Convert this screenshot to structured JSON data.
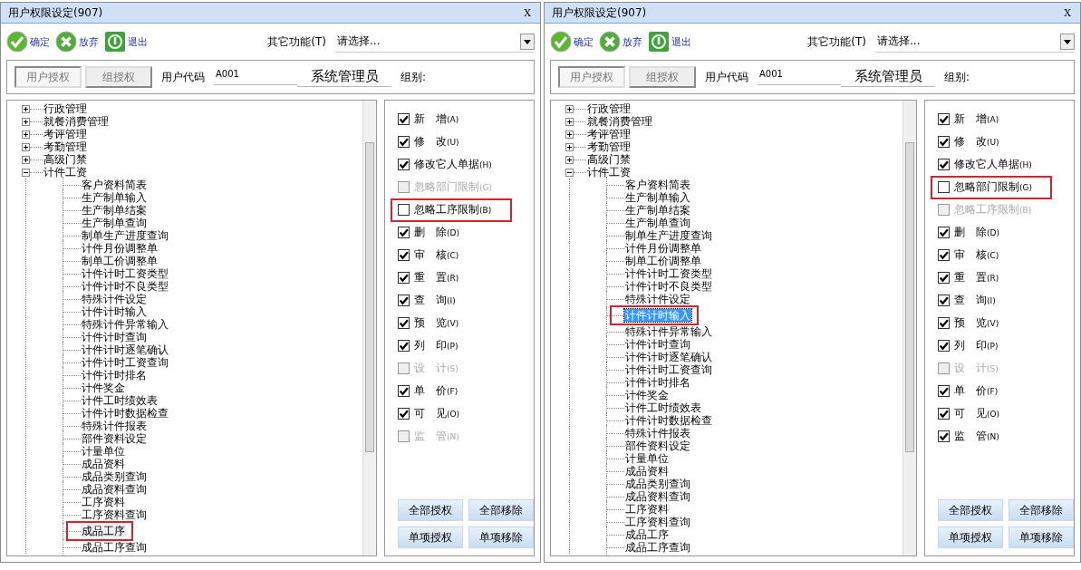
{
  "windows": [
    {
      "title": "用户权限设定(907)",
      "close": "X",
      "tree_focused": false,
      "toolbar": [
        {
          "kind": "ok",
          "label": "确定"
        },
        {
          "kind": "cancel",
          "label": "放弃"
        },
        {
          "kind": "exit",
          "label": "退出"
        }
      ],
      "other_label": "其它功能(T)",
      "other_value": "请选择...",
      "tabs": [
        {
          "label": "用户授权",
          "selected": true
        },
        {
          "label": "组授权",
          "selected": false
        }
      ],
      "user_code_label": "用户代码",
      "user_code": "A001",
      "user_name": "系统管理员",
      "group_label": "组别:",
      "tree": [
        {
          "label": "行政管理",
          "expanded": false
        },
        {
          "label": "就餐消费管理",
          "expanded": false
        },
        {
          "label": "考评管理",
          "expanded": false
        },
        {
          "label": "考勤管理",
          "expanded": false
        },
        {
          "label": "高级门禁",
          "expanded": false
        },
        {
          "label": "计件工资",
          "expanded": true,
          "children": [
            {
              "label": "客户资料简表",
              "selected": false,
              "highlighted": false
            },
            {
              "label": "生产制单输入",
              "selected": false,
              "highlighted": false
            },
            {
              "label": "生产制单结案",
              "selected": false,
              "highlighted": false
            },
            {
              "label": "生产制单查询",
              "selected": false,
              "highlighted": false
            },
            {
              "label": "制单生产进度查询",
              "selected": false,
              "highlighted": false
            },
            {
              "label": "计件月份调整单",
              "selected": false,
              "highlighted": false
            },
            {
              "label": "制单工价调整单",
              "selected": false,
              "highlighted": false
            },
            {
              "label": "计件计时工资类型",
              "selected": false,
              "highlighted": false
            },
            {
              "label": "计件计时不良类型",
              "selected": false,
              "highlighted": false
            },
            {
              "label": "特殊计件设定",
              "selected": false,
              "highlighted": false
            },
            {
              "label": "计件计时输入",
              "selected": false,
              "highlighted": false
            },
            {
              "label": "特殊计件异常输入",
              "selected": false,
              "highlighted": false
            },
            {
              "label": "计件计时查询",
              "selected": false,
              "highlighted": false
            },
            {
              "label": "计件计时逐笔确认",
              "selected": false,
              "highlighted": false
            },
            {
              "label": "计件计时工资查询",
              "selected": false,
              "highlighted": false
            },
            {
              "label": "计件计时排名",
              "selected": false,
              "highlighted": false
            },
            {
              "label": "计件奖金",
              "selected": false,
              "highlighted": false
            },
            {
              "label": "计件工时绩效表",
              "selected": false,
              "highlighted": false
            },
            {
              "label": "计件计时数据检查",
              "selected": false,
              "highlighted": false
            },
            {
              "label": "特殊计件报表",
              "selected": false,
              "highlighted": false
            },
            {
              "label": "部件资料设定",
              "selected": false,
              "highlighted": false
            },
            {
              "label": "计量单位",
              "selected": false,
              "highlighted": false
            },
            {
              "label": "成品资料",
              "selected": false,
              "highlighted": false
            },
            {
              "label": "成品类别查询",
              "selected": false,
              "highlighted": false
            },
            {
              "label": "成品资料查询",
              "selected": false,
              "highlighted": false
            },
            {
              "label": "工序资料",
              "selected": false,
              "highlighted": false
            },
            {
              "label": "工序资料查询",
              "selected": false,
              "highlighted": false
            },
            {
              "label": "成品工序",
              "selected": true,
              "highlighted": true
            },
            {
              "label": "成品工序查询",
              "selected": false,
              "highlighted": false
            }
          ]
        }
      ],
      "permissions": [
        {
          "label": "新　增",
          "key": "(A)",
          "checked": true,
          "disabled": false,
          "highlighted": false
        },
        {
          "label": "修　改",
          "key": "(U)",
          "checked": true,
          "disabled": false,
          "highlighted": false
        },
        {
          "label": "修改它人单据",
          "key": "(H)",
          "checked": true,
          "disabled": false,
          "highlighted": false
        },
        {
          "label": "忽略部门限制",
          "key": "(G)",
          "checked": false,
          "disabled": true,
          "highlighted": false
        },
        {
          "label": "忽略工序限制",
          "key": "(B)",
          "checked": false,
          "disabled": false,
          "highlighted": true
        },
        {
          "label": "删　除",
          "key": "(D)",
          "checked": true,
          "disabled": false,
          "highlighted": false
        },
        {
          "label": "审　核",
          "key": "(C)",
          "checked": true,
          "disabled": false,
          "highlighted": false
        },
        {
          "label": "重　置",
          "key": "(R)",
          "checked": true,
          "disabled": false,
          "highlighted": false
        },
        {
          "label": "查　询",
          "key": "(I)",
          "checked": true,
          "disabled": false,
          "highlighted": false
        },
        {
          "label": "预　览",
          "key": "(V)",
          "checked": true,
          "disabled": false,
          "highlighted": false
        },
        {
          "label": "列　印",
          "key": "(P)",
          "checked": true,
          "disabled": false,
          "highlighted": false
        },
        {
          "label": "设　计",
          "key": "(S)",
          "checked": false,
          "disabled": true,
          "highlighted": false
        },
        {
          "label": "单　价",
          "key": "(F)",
          "checked": true,
          "disabled": false,
          "highlighted": false
        },
        {
          "label": "可　见",
          "key": "(O)",
          "checked": true,
          "disabled": false,
          "highlighted": false
        },
        {
          "label": "监　管",
          "key": "(N)",
          "checked": false,
          "disabled": true,
          "highlighted": false
        }
      ],
      "buttons": [
        "全部授权",
        "全部移除",
        "单项授权",
        "单项移除"
      ]
    },
    {
      "title": "用户权限设定(907)",
      "close": "X",
      "tree_focused": true,
      "toolbar": [
        {
          "kind": "ok",
          "label": "确定"
        },
        {
          "kind": "cancel",
          "label": "放弃"
        },
        {
          "kind": "exit",
          "label": "退出"
        }
      ],
      "other_label": "其它功能(T)",
      "other_value": "请选择...",
      "tabs": [
        {
          "label": "用户授权",
          "selected": true
        },
        {
          "label": "组授权",
          "selected": false
        }
      ],
      "user_code_label": "用户代码",
      "user_code": "A001",
      "user_name": "系统管理员",
      "group_label": "组别:",
      "tree": [
        {
          "label": "行政管理",
          "expanded": false
        },
        {
          "label": "就餐消费管理",
          "expanded": false
        },
        {
          "label": "考评管理",
          "expanded": false
        },
        {
          "label": "考勤管理",
          "expanded": false
        },
        {
          "label": "高级门禁",
          "expanded": false
        },
        {
          "label": "计件工资",
          "expanded": true,
          "children": [
            {
              "label": "客户资料简表",
              "selected": false,
              "highlighted": false
            },
            {
              "label": "生产制单输入",
              "selected": false,
              "highlighted": false
            },
            {
              "label": "生产制单结案",
              "selected": false,
              "highlighted": false
            },
            {
              "label": "生产制单查询",
              "selected": false,
              "highlighted": false
            },
            {
              "label": "制单生产进度查询",
              "selected": false,
              "highlighted": false
            },
            {
              "label": "计件月份调整单",
              "selected": false,
              "highlighted": false
            },
            {
              "label": "制单工价调整单",
              "selected": false,
              "highlighted": false
            },
            {
              "label": "计件计时工资类型",
              "selected": false,
              "highlighted": false
            },
            {
              "label": "计件计时不良类型",
              "selected": false,
              "highlighted": false
            },
            {
              "label": "特殊计件设定",
              "selected": false,
              "highlighted": false
            },
            {
              "label": "计件计时输入",
              "selected": true,
              "highlighted": true
            },
            {
              "label": "特殊计件异常输入",
              "selected": false,
              "highlighted": false
            },
            {
              "label": "计件计时查询",
              "selected": false,
              "highlighted": false
            },
            {
              "label": "计件计时逐笔确认",
              "selected": false,
              "highlighted": false
            },
            {
              "label": "计件计时工资查询",
              "selected": false,
              "highlighted": false
            },
            {
              "label": "计件计时排名",
              "selected": false,
              "highlighted": false
            },
            {
              "label": "计件奖金",
              "selected": false,
              "highlighted": false
            },
            {
              "label": "计件工时绩效表",
              "selected": false,
              "highlighted": false
            },
            {
              "label": "计件计时数据检查",
              "selected": false,
              "highlighted": false
            },
            {
              "label": "特殊计件报表",
              "selected": false,
              "highlighted": false
            },
            {
              "label": "部件资料设定",
              "selected": false,
              "highlighted": false
            },
            {
              "label": "计量单位",
              "selected": false,
              "highlighted": false
            },
            {
              "label": "成品资料",
              "selected": false,
              "highlighted": false
            },
            {
              "label": "成品类别查询",
              "selected": false,
              "highlighted": false
            },
            {
              "label": "成品资料查询",
              "selected": false,
              "highlighted": false
            },
            {
              "label": "工序资料",
              "selected": false,
              "highlighted": false
            },
            {
              "label": "工序资料查询",
              "selected": false,
              "highlighted": false
            },
            {
              "label": "成品工序",
              "selected": false,
              "highlighted": false
            },
            {
              "label": "成品工序查询",
              "selected": false,
              "highlighted": false
            }
          ]
        }
      ],
      "permissions": [
        {
          "label": "新　增",
          "key": "(A)",
          "checked": true,
          "disabled": false,
          "highlighted": false
        },
        {
          "label": "修　改",
          "key": "(U)",
          "checked": true,
          "disabled": false,
          "highlighted": false
        },
        {
          "label": "修改它人单据",
          "key": "(H)",
          "checked": true,
          "disabled": false,
          "highlighted": false
        },
        {
          "label": "忽略部门限制",
          "key": "(G)",
          "checked": false,
          "disabled": false,
          "highlighted": true
        },
        {
          "label": "忽略工序限制",
          "key": "(B)",
          "checked": false,
          "disabled": true,
          "highlighted": false
        },
        {
          "label": "删　除",
          "key": "(D)",
          "checked": true,
          "disabled": false,
          "highlighted": false
        },
        {
          "label": "审　核",
          "key": "(C)",
          "checked": true,
          "disabled": false,
          "highlighted": false
        },
        {
          "label": "重　置",
          "key": "(R)",
          "checked": true,
          "disabled": false,
          "highlighted": false
        },
        {
          "label": "查　询",
          "key": "(I)",
          "checked": true,
          "disabled": false,
          "highlighted": false
        },
        {
          "label": "预　览",
          "key": "(V)",
          "checked": true,
          "disabled": false,
          "highlighted": false
        },
        {
          "label": "列　印",
          "key": "(P)",
          "checked": true,
          "disabled": false,
          "highlighted": false
        },
        {
          "label": "设　计",
          "key": "(S)",
          "checked": false,
          "disabled": true,
          "highlighted": false
        },
        {
          "label": "单　价",
          "key": "(F)",
          "checked": true,
          "disabled": false,
          "highlighted": false
        },
        {
          "label": "可　见",
          "key": "(O)",
          "checked": true,
          "disabled": false,
          "highlighted": false
        },
        {
          "label": "监　管",
          "key": "(N)",
          "checked": true,
          "disabled": false,
          "highlighted": false
        }
      ],
      "buttons": [
        "全部授权",
        "全部移除",
        "单项授权",
        "单项移除"
      ]
    }
  ]
}
